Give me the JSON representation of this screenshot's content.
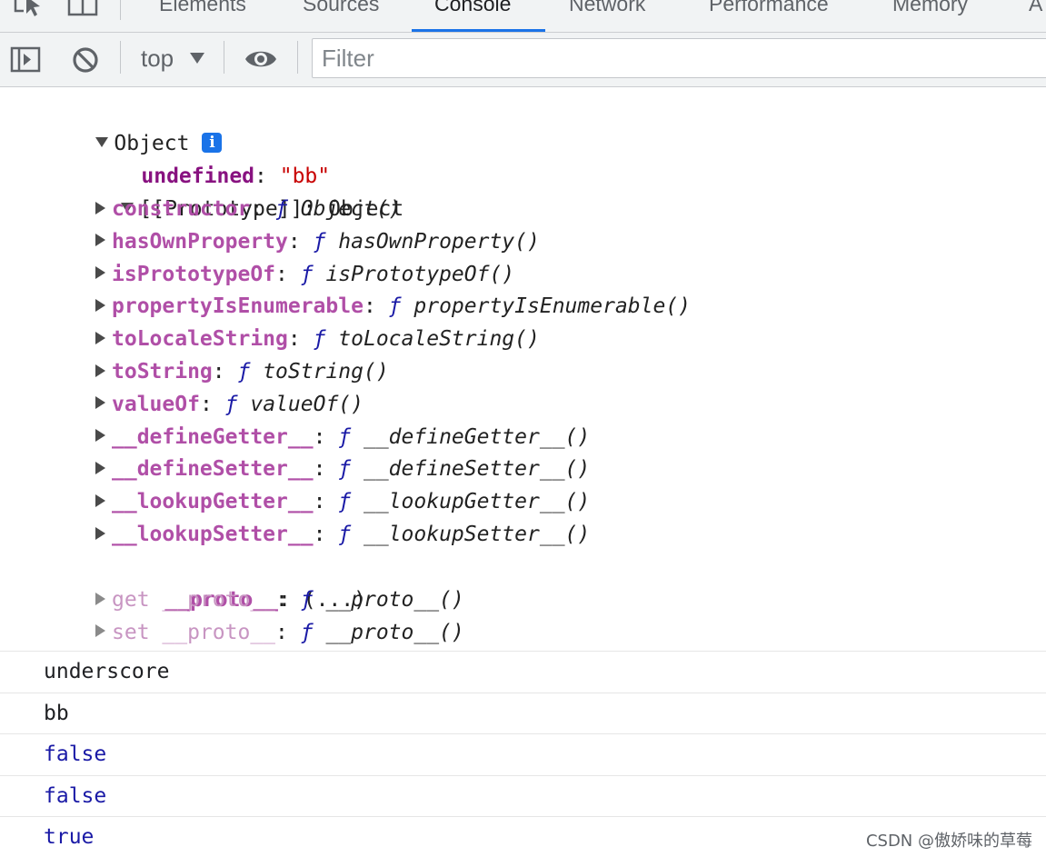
{
  "tabs": [
    {
      "label": "Elements"
    },
    {
      "label": "Sources"
    },
    {
      "label": "Console",
      "active": true
    },
    {
      "label": "Network"
    },
    {
      "label": "Performance"
    },
    {
      "label": "Memory"
    },
    {
      "label": "A"
    }
  ],
  "toolbar": {
    "context_value": "top",
    "filter_placeholder": "Filter"
  },
  "object_tree": {
    "header": "Object",
    "own_property": {
      "key": "undefined",
      "value": "\"bb\""
    },
    "prototype_label": "[[Prototype]]",
    "prototype_type": "Object",
    "methods": [
      {
        "key": "constructor",
        "sig": "Object()"
      },
      {
        "key": "hasOwnProperty",
        "sig": "hasOwnProperty()"
      },
      {
        "key": "isPrototypeOf",
        "sig": "isPrototypeOf()"
      },
      {
        "key": "propertyIsEnumerable",
        "sig": "propertyIsEnumerable()"
      },
      {
        "key": "toLocaleString",
        "sig": "toLocaleString()"
      },
      {
        "key": "toString",
        "sig": "toString()"
      },
      {
        "key": "valueOf",
        "sig": "valueOf()"
      },
      {
        "key": "__defineGetter__",
        "sig": "__defineGetter__()"
      },
      {
        "key": "__defineSetter__",
        "sig": "__defineSetter__()"
      },
      {
        "key": "__lookupGetter__",
        "sig": "__lookupGetter__()"
      },
      {
        "key": "__lookupSetter__",
        "sig": "__lookupSetter__()"
      }
    ],
    "proto_key": "__proto__",
    "proto_value": "(...)",
    "accessors": [
      {
        "key": "get __proto__",
        "sig": "__proto__()"
      },
      {
        "key": "set __proto__",
        "sig": "__proto__()"
      }
    ]
  },
  "log_lines": [
    {
      "text": "underscore",
      "kind": "plain"
    },
    {
      "text": "bb",
      "kind": "plain"
    },
    {
      "text": "false",
      "kind": "bool"
    },
    {
      "text": "false",
      "kind": "bool"
    },
    {
      "text": "true",
      "kind": "bool"
    }
  ],
  "watermark": "CSDN @傲娇味的草莓",
  "colors": {
    "accent": "#1a73e8",
    "property_key": "#881280",
    "string_value": "#c80000",
    "function_glyph": "#1a1aa6"
  },
  "icons": [
    "inspect-icon",
    "device-toggle-icon",
    "sidebar-toggle-icon",
    "clear-console-icon",
    "dropdown-caret-icon",
    "eye-icon",
    "info-icon"
  ],
  "function_glyph": "ƒ"
}
